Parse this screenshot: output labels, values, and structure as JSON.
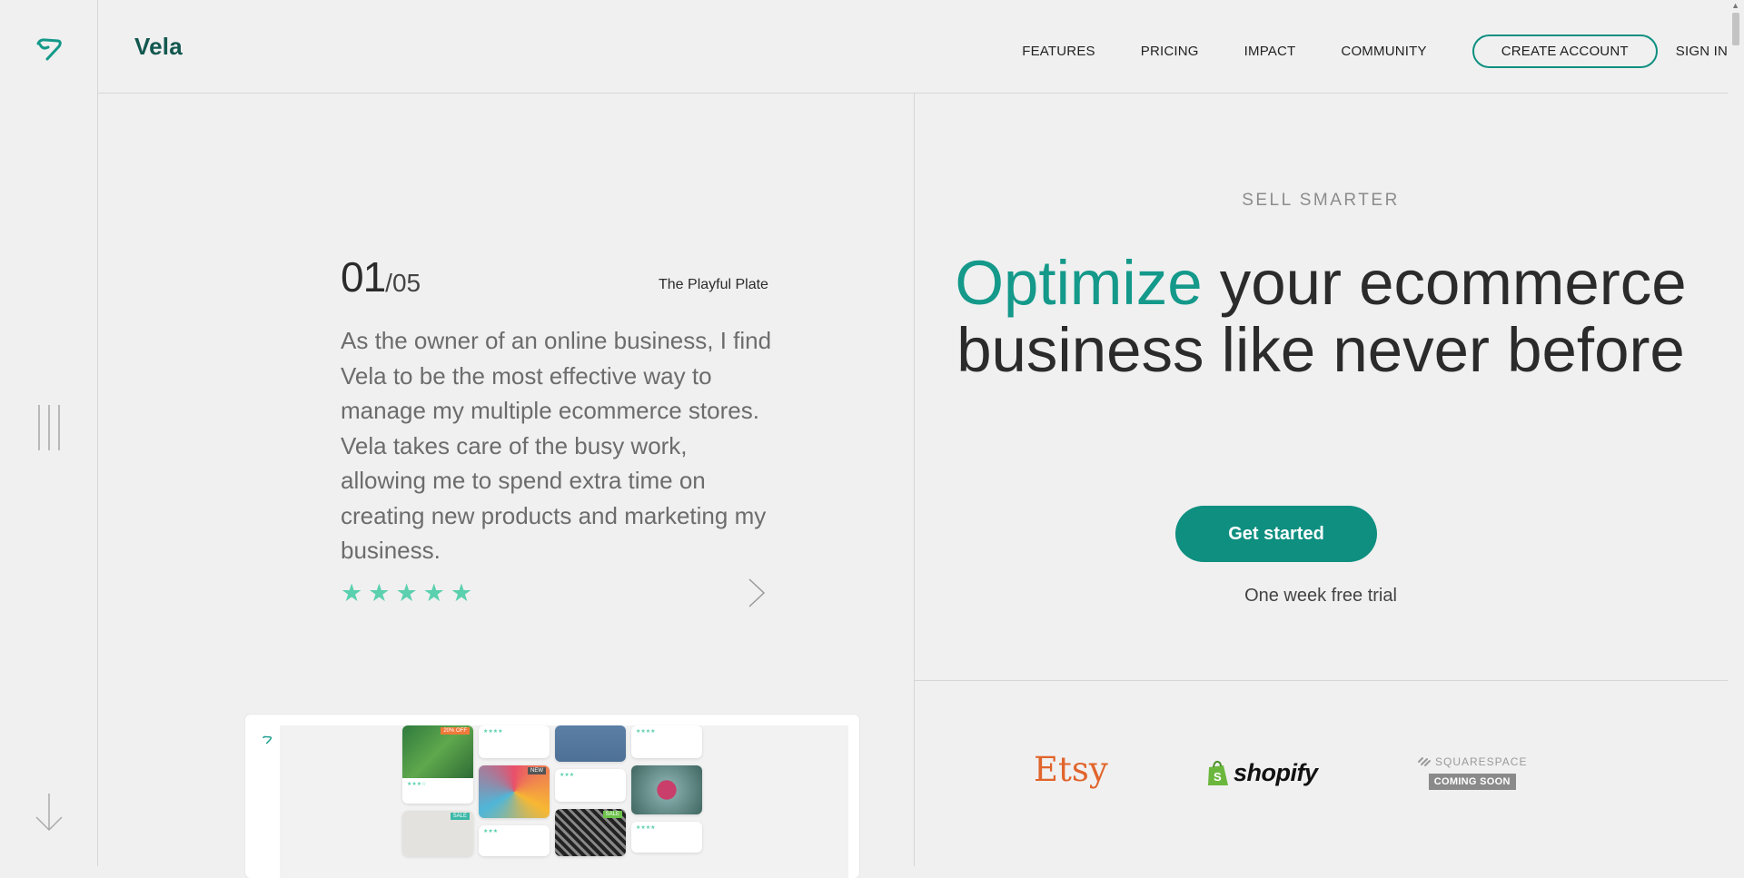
{
  "header": {
    "brand": "Vela",
    "nav": [
      {
        "label": "FEATURES"
      },
      {
        "label": "PRICING"
      },
      {
        "label": "IMPACT"
      },
      {
        "label": "COMMUNITY"
      }
    ],
    "create_account": "CREATE ACCOUNT",
    "sign_in": "SIGN IN"
  },
  "testimonial": {
    "index": "01",
    "total": "/05",
    "author": "The Playful Plate",
    "quote": "As the owner of an online business, I find Vela to be the most effective way to manage my multiple ecommerce stores. Vela takes care of the busy work, allowing me to spend extra time on creating new products and marketing my business.",
    "rating": 5
  },
  "hero": {
    "eyebrow": "SELL SMARTER",
    "headline_accent": "Optimize",
    "headline_rest": " your ecommerce business like never before",
    "cta": "Get started",
    "trial": "One week free trial"
  },
  "partners": {
    "etsy": "Etsy",
    "shopify": "shopify",
    "squarespace": "SQUARESPACE",
    "coming_soon": "COMING SOON"
  },
  "preview": {
    "badges": [
      "20% OFF",
      "NEW",
      "SALE",
      "SALE"
    ]
  },
  "colors": {
    "brand": "#13584f",
    "accent": "#14998a",
    "button": "#0e8f80",
    "stars": "#5bd0ae",
    "etsy": "#e1642b"
  }
}
